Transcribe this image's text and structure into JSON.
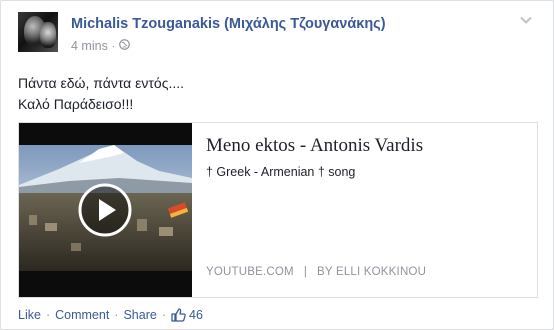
{
  "post": {
    "author": "Michalis Tzouganakis (Μιχάλης Τζουγανάκης)",
    "time": "4 mins",
    "separator": "·",
    "text_lines": [
      "Πάντα εδώ, πάντα εντός....",
      "Καλό Παράδεισο!!!"
    ]
  },
  "link": {
    "title": "Meno ektos - Antonis Vardis",
    "description": "† Greek - Armenian † song",
    "domain": "YOUTUBE.COM",
    "separator": "|",
    "byline": "BY ELLI KOKKINOU"
  },
  "actions": {
    "like": "Like",
    "comment": "Comment",
    "share": "Share",
    "dot": "·",
    "like_count": "46"
  },
  "icons": {
    "privacy": "globe-icon",
    "options": "chevron-down-icon",
    "play": "play-icon",
    "thumbs_up": "thumbs-up-icon"
  },
  "colors": {
    "link_blue": "#3b5998",
    "meta_gray": "#90949c",
    "text": "#1d2129"
  }
}
